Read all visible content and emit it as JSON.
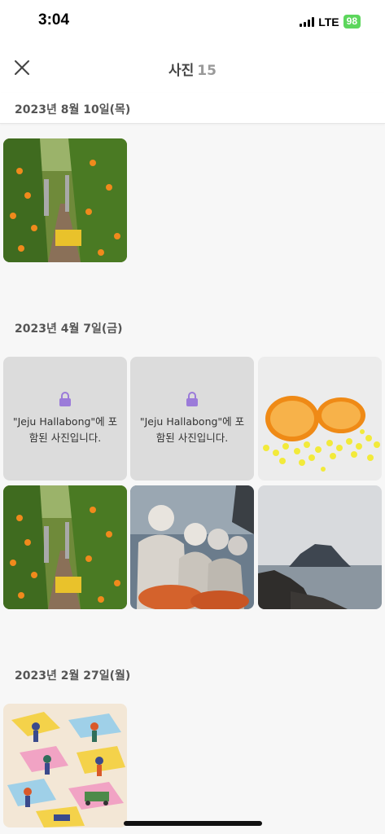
{
  "status_bar": {
    "time": "3:04",
    "network": "LTE",
    "battery": "98"
  },
  "header": {
    "title": "사진",
    "count": "15"
  },
  "groups": [
    {
      "date": "2023년 8월 10일(목)",
      "photos": [
        {
          "icon": "orange-orchard-photo"
        }
      ]
    },
    {
      "date": "2023년 4월 7일(금)",
      "photos": [
        {
          "locked": true,
          "text_line1": "\"Jeju Hallabong\"에 포",
          "text_line2": "함된 사진입니다."
        },
        {
          "locked": true,
          "text_line1": "\"Jeju Hallabong\"에 포",
          "text_line2": "함된 사진입니다."
        },
        {
          "icon": "sliced-orange-photo"
        },
        {
          "icon": "orange-orchard-photo"
        },
        {
          "icon": "haenyeo-women-photo"
        },
        {
          "icon": "island-sea-photo"
        }
      ]
    },
    {
      "date": "2023년 2월 27일(월)",
      "photos": [
        {
          "icon": "illustration-photo"
        }
      ]
    }
  ],
  "colors": {
    "background": "#f7f7f7",
    "locked_tile": "#dcdcdc",
    "lock_icon": "#9b7bd9",
    "battery": "#5cd65c"
  }
}
